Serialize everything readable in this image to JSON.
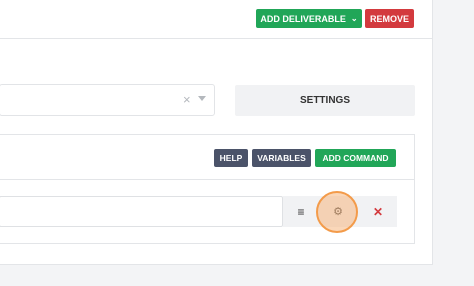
{
  "header": {
    "add_deliverable_label": "ADD DELIVERABLE",
    "add_deliverable_chevron": "⌄",
    "remove_label": "REMOVE"
  },
  "target_select": {
    "clear_glyph": "×",
    "value": ""
  },
  "settings_label": "SETTINGS",
  "commands": {
    "help_label": "HELP",
    "variables_label": "VARIABLES",
    "add_command_label": "ADD COMMAND",
    "command_value": "",
    "menu_glyph": "≡",
    "gear_glyph": "⚙",
    "delete_glyph": "✕"
  },
  "colors": {
    "green": "#21a658",
    "red": "#d33a3e",
    "slate": "#4b5369",
    "highlight": "#f39b4a"
  }
}
